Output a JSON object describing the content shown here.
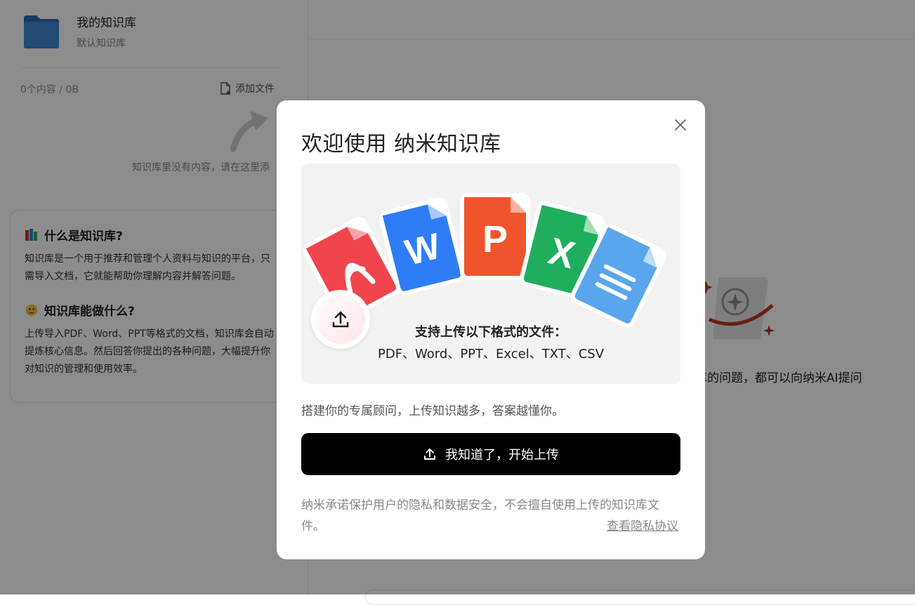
{
  "kb": {
    "title": "我的知识库",
    "subtitle": "默认知识库",
    "stats": "0个内容 / 0B",
    "add_file_label": "添加文件",
    "empty_hint": "知识库里没有内容，请在这里添"
  },
  "info_card": {
    "what_title": "什么是知识库?",
    "what_body": "知识库是一个用于推荐和管理个人资料与知识的平台，只需导入文档，它就能帮助你理解内容并解答问题。",
    "do_title": "知识库能做什么?",
    "do_body": "上传导入PDF、Word、PPT等格式的文档，知识库会自动提炼核心信息。然后回答你提出的各种问题，大幅提升你对知识的管理和使用效率。"
  },
  "right_panel": {
    "hint_text": "库的问题，都可以向纳米AI提问"
  },
  "modal": {
    "title": "欢迎使用 纳米知识库",
    "formats_line1": "支持上传以下格式的文件：",
    "formats_line2": "PDF、Word、PPT、Excel、TXT、CSV",
    "file_icons": [
      "pdf-icon",
      "word-icon",
      "ppt-icon",
      "excel-icon",
      "txt-icon"
    ],
    "file_letters": {
      "word": "W",
      "ppt": "P",
      "excel": "X"
    },
    "description": "搭建你的专属顾问，上传知识越多，答案越懂你。",
    "primary_button": "我知道了，开始上传",
    "privacy_text": "纳米承诺保护用户的隐私和数据安全，不会擅自使用上传的知识库文件。",
    "privacy_link": "查看隐私协议"
  },
  "colors": {
    "pdf": "#f0454d",
    "word": "#2f7df6",
    "ppt": "#f0542c",
    "excel": "#1fae5c",
    "txt": "#5aa6ec",
    "button_bg": "#000000",
    "overlay": "rgba(0,0,0,0.45)"
  }
}
